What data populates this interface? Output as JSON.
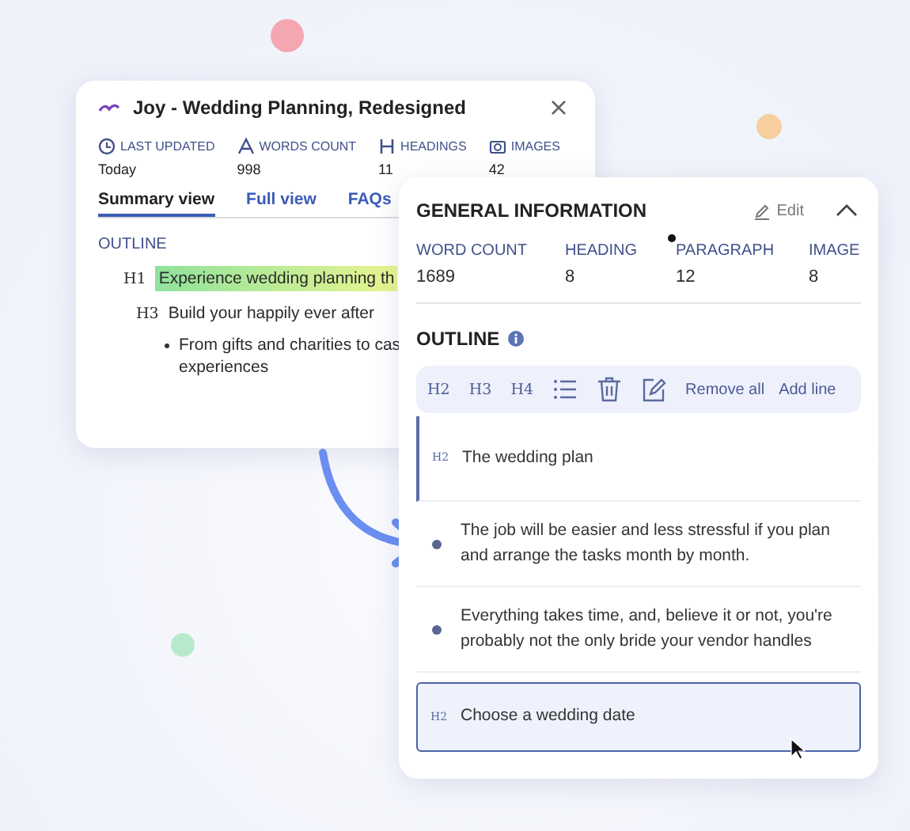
{
  "back_window": {
    "title": "Joy - Wedding Planning, Redesigned",
    "stats": [
      {
        "kind": "clock",
        "label": "LAST UPDATED",
        "value": "Today"
      },
      {
        "kind": "letter",
        "label": "WORDS COUNT",
        "value": "998"
      },
      {
        "kind": "heading",
        "label": "HEADINGS",
        "value": "11"
      },
      {
        "kind": "camera",
        "label": "IMAGES",
        "value": "42"
      }
    ],
    "tabs": [
      {
        "label": "Summary view",
        "selected": true
      },
      {
        "label": "Full view",
        "selected": false
      },
      {
        "label": "FAQs",
        "selected": false
      }
    ],
    "outline_title": "OUTLINE",
    "outline": [
      {
        "kind": "heading",
        "tag": "H1",
        "text": "Experience wedding planning th",
        "highlighted": true
      },
      {
        "kind": "heading",
        "tag": "H3",
        "text": "Build your happily ever after",
        "highlighted": false
      },
      {
        "kind": "bullet",
        "text": "From gifts and charities to cas",
        "highlighted": false
      },
      {
        "kind": "plain",
        "text": "experiences",
        "highlighted": false
      }
    ]
  },
  "front_panel": {
    "title": "GENERAL INFORMATION",
    "edit": "Edit",
    "expanded": true,
    "stats": [
      {
        "label": "WORD COUNT",
        "value": "1689"
      },
      {
        "label": "HEADING",
        "value": "8"
      },
      {
        "label": "PARAGRAPH",
        "value": "12"
      },
      {
        "label": "IMAGE",
        "value": "8"
      }
    ],
    "outline_title": "OUTLINE",
    "toolbar": [
      {
        "kind": "text",
        "label": "H2"
      },
      {
        "kind": "text",
        "label": "H3"
      },
      {
        "kind": "text",
        "label": "H4"
      },
      {
        "kind": "list"
      },
      {
        "kind": "trash"
      },
      {
        "kind": "edit"
      },
      {
        "kind": "link",
        "label": "Remove all"
      },
      {
        "kind": "link",
        "label": "Add line"
      }
    ],
    "items": [
      {
        "kind": "heading",
        "tag": "H2",
        "text": "The wedding plan",
        "current": true,
        "selected": false
      },
      {
        "kind": "bullet",
        "text": "The job will be easier and less stressful if you plan and arrange the tasks month by month.",
        "current": false,
        "selected": false
      },
      {
        "kind": "bullet",
        "text": "Everything takes time, and, believe it or not, you're probably not the only bride your vendor handles",
        "current": false,
        "selected": false
      },
      {
        "kind": "heading",
        "tag": "H2",
        "text": "Choose a wedding date",
        "current": false,
        "selected": true
      }
    ]
  }
}
